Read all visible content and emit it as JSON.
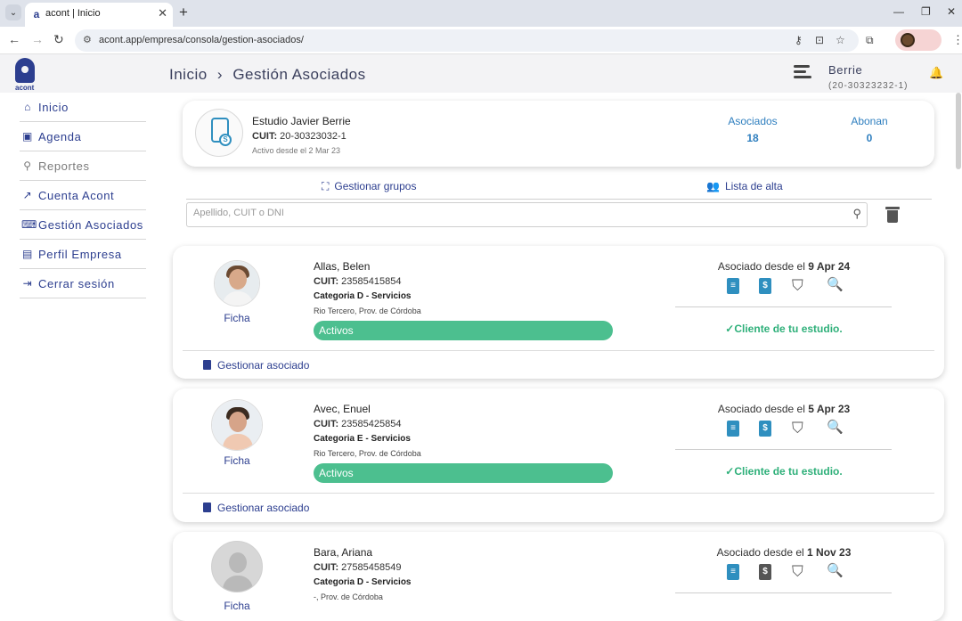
{
  "browser": {
    "tab_title": "acont | Inicio",
    "url": "acont.app/empresa/consola/gestion-asociados/"
  },
  "header": {
    "logo_text": "acont",
    "breadcrumb_home": "Inicio",
    "breadcrumb_sep": "›",
    "breadcrumb_current": "Gestión Asociados",
    "user_name": "Berrie",
    "user_cuit": "(20-30323232-1)"
  },
  "sidebar": {
    "items": [
      {
        "label": "Inicio",
        "icon": "home-icon"
      },
      {
        "label": "Agenda",
        "icon": "agenda-icon"
      },
      {
        "label": "Reportes",
        "icon": "reports-icon"
      },
      {
        "label": "Cuenta Acont",
        "icon": "chart-icon"
      },
      {
        "label": "Gestión Asociados",
        "icon": "keyboard-icon"
      },
      {
        "label": "Perfil Empresa",
        "icon": "id-card-icon"
      },
      {
        "label": "Cerrar sesión",
        "icon": "logout-icon"
      }
    ]
  },
  "company": {
    "name": "Estudio Javier Berrie",
    "cuit_label": "CUIT:",
    "cuit": "20-30323032-1",
    "since": "Activo desde el 2 Mar 23",
    "stats": [
      {
        "label": "Asociados",
        "value": "18"
      },
      {
        "label": "Abonan",
        "value": "0"
      }
    ]
  },
  "actions": {
    "groups": "Gestionar grupos",
    "signup_list": "Lista de alta"
  },
  "search": {
    "placeholder": "Apellido, CUIT o DNI"
  },
  "associates": [
    {
      "name": "Allas, Belen",
      "cuit_label": "CUIT:",
      "cuit": "23585415854",
      "category": "Categoria D - Servicios",
      "location": "Rio Tercero, Prov. de Córdoba",
      "status": "Activos",
      "since_prefix": "Asociado desde el",
      "since_date": "9 Apr 24",
      "client_text": "✓Cliente de tu estudio.",
      "ficha": "Ficha",
      "manage": "Gestionar asociado"
    },
    {
      "name": "Avec, Enuel",
      "cuit_label": "CUIT:",
      "cuit": "23585425854",
      "category": "Categoria E - Servicios",
      "location": "Rio Tercero, Prov. de Córdoba",
      "status": "Activos",
      "since_prefix": "Asociado desde el",
      "since_date": "5 Apr 23",
      "client_text": "✓Cliente de tu estudio.",
      "ficha": "Ficha",
      "manage": "Gestionar asociado"
    },
    {
      "name": "Bara, Ariana",
      "cuit_label": "CUIT:",
      "cuit": "27585458549",
      "category": "Categoria D - Servicios",
      "location": "-, Prov. de Córdoba",
      "since_prefix": "Asociado desde el",
      "since_date": "1 Nov 23",
      "ficha": "Ficha"
    }
  ],
  "colors": {
    "brand": "#2c3e8f",
    "accent": "#2f8fbf",
    "status_active": "#4cbf8f",
    "client_green": "#2fb07a"
  }
}
